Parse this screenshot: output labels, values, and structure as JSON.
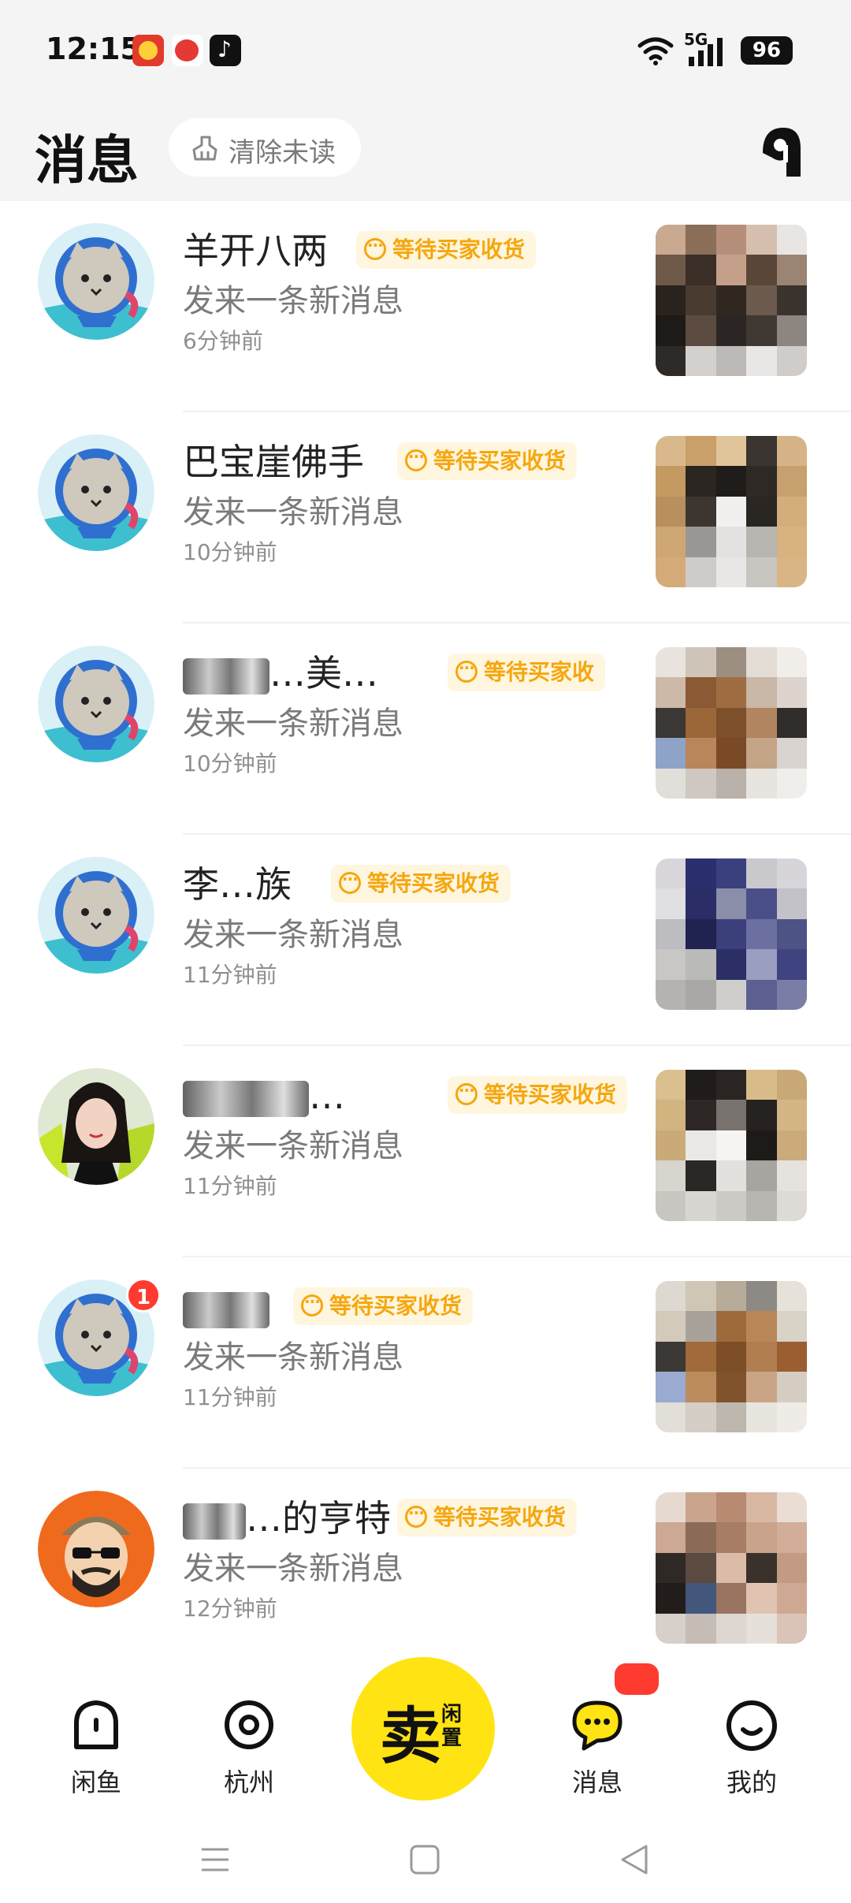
{
  "status_bar": {
    "time": "12:15",
    "network": "5G",
    "battery": "96",
    "apps": [
      "food-delivery-app-icon",
      "video-app-icon",
      "tiktok-icon"
    ]
  },
  "header": {
    "title": "消息",
    "clear_unread": "清除未读"
  },
  "conversations": [
    {
      "name": "羊开八两",
      "status": "等待买家收货",
      "preview": "发来一条新消息",
      "time": "6分钟前",
      "unread": "",
      "avatar": "cat-avatar"
    },
    {
      "name": "巴宝崖佛手",
      "status": "等待买家收货",
      "preview": "发来一条新消息",
      "time": "10分钟前",
      "unread": "",
      "avatar": "cat-avatar"
    },
    {
      "name": "…美…",
      "status": "等待买家收",
      "preview": "发来一条新消息",
      "time": "10分钟前",
      "unread": "",
      "avatar": "cat-avatar"
    },
    {
      "name": "李…族",
      "status": "等待买家收货",
      "preview": "发来一条新消息",
      "time": "11分钟前",
      "unread": "",
      "avatar": "cat-avatar"
    },
    {
      "name": "…",
      "status": "等待买家收货",
      "preview": "发来一条新消息",
      "time": "11分钟前",
      "unread": "",
      "avatar": "photo-avatar"
    },
    {
      "name": "",
      "status": "等待买家收货",
      "preview": "发来一条新消息",
      "time": "11分钟前",
      "unread": "1",
      "avatar": "cat-avatar"
    },
    {
      "name": "…的亨特",
      "status": "等待买家收货",
      "preview": "发来一条新消息",
      "time": "12分钟前",
      "unread": "",
      "avatar": "cartoon-avatar"
    }
  ],
  "bottom_nav": {
    "home": "闲鱼",
    "city": "杭州",
    "sell_main": "卖",
    "sell_sub": "闲置",
    "messages": "消息",
    "mine": "我的"
  },
  "colors": {
    "accent": "#ffe312",
    "tag_text": "#f5a70f",
    "tag_bg": "#fff6df",
    "badge": "#ff3b30"
  }
}
